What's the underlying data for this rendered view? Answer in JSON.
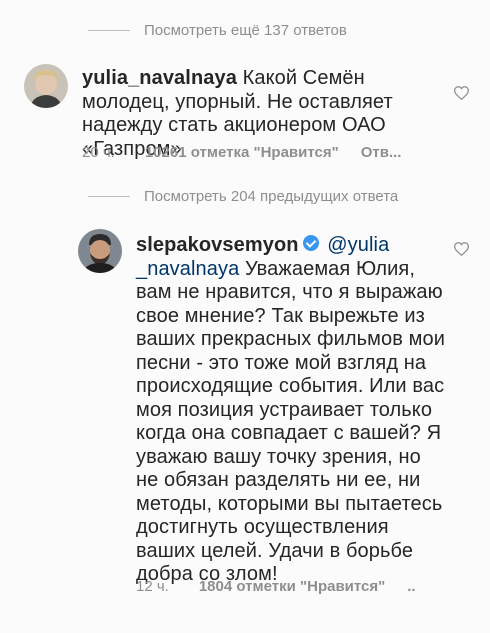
{
  "thread1": {
    "view_more": "Посмотреть ещё 137 ответов"
  },
  "comment1": {
    "username": "yulia_navalnaya",
    "text": "Какой Семён молодец, упорный. Не оставляет надежду стать акционером  ОАО «Газпром»",
    "time": "20 ч.",
    "likes": "10261 отметка \"Нравится\"",
    "reply": "Отв..."
  },
  "thread2": {
    "view_prev": "Посмотреть 204 предыдущих ответа"
  },
  "comment2": {
    "username": "slepakovsemyon",
    "mention_1": "@yulia",
    "mention_2": "_navalnaya",
    "line_1": "Уважаемая Юлия,",
    "line_2": "вам не нравится, что я выражаю",
    "line_3": "свое мнение? Так вырежьте из",
    "line_4": "ваших прекрасных фильмов мои",
    "line_5": "песни - это тоже мой взгляд на",
    "line_6": "происходящие события. Или вас",
    "line_7": "моя позиция устраивает только",
    "line_8": "когда она совпадает с вашей? Я",
    "line_9": "уважаю вашу точку зрения, но",
    "line_10": "не обязан разделять ни ее, ни",
    "line_11": "методы, которыми вы пытаетесь",
    "line_12": "достигнуть осуществления",
    "line_13": "ваших целей. Удачи в борьбе",
    "line_14": "добра со злом!",
    "time": "12 ч.",
    "likes": "1804 отметки \"Нравится\"",
    "more": ".."
  },
  "icons": {
    "heart": "heart-outline-icon",
    "verified": "verified-badge-icon"
  },
  "colors": {
    "muted_text": "#8e8e8e",
    "text": "#262626",
    "mention": "#00376b",
    "verified": "#3897f0"
  }
}
